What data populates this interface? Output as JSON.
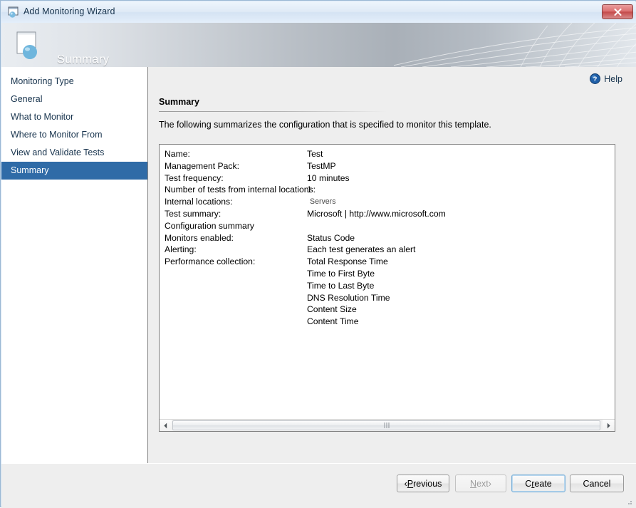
{
  "window": {
    "title": "Add Monitoring Wizard",
    "icon": "wizard-window-icon",
    "close_label": "x"
  },
  "banner": {
    "title": "Summary",
    "icon": "wizard-page-icon"
  },
  "sidebar": {
    "items": [
      {
        "label": "Monitoring Type",
        "selected": false
      },
      {
        "label": "General",
        "selected": false
      },
      {
        "label": "What to Monitor",
        "selected": false
      },
      {
        "label": "Where to Monitor From",
        "selected": false
      },
      {
        "label": "View and Validate Tests",
        "selected": false
      },
      {
        "label": "Summary",
        "selected": true
      }
    ],
    "selected_color": "#2f6ba7"
  },
  "content": {
    "help_label": "Help",
    "help_icon": "help-circle-icon",
    "section_title": "Summary",
    "intro_text": "The following summarizes the configuration that is specified to monitor this template.",
    "rows": [
      {
        "label": "Name:",
        "value": "Test",
        "sub": false
      },
      {
        "label": "Management Pack:",
        "value": "TestMP",
        "sub": false
      },
      {
        "label": "Test frequency:",
        "value": "10 minutes",
        "sub": false
      },
      {
        "label": "Number of tests from internal locations:",
        "value": "1",
        "sub": false
      },
      {
        "label": "Internal locations:",
        "value": "Servers",
        "sub": true
      },
      {
        "label": "Test summary:",
        "value": "Microsoft | http://www.microsoft.com",
        "sub": false
      },
      {
        "label": "Configuration summary",
        "value": "",
        "sub": false
      },
      {
        "label": "Monitors enabled:",
        "value": "Status Code",
        "sub": false
      },
      {
        "label": "Alerting:",
        "value": "Each test generates an alert",
        "sub": false
      },
      {
        "label": "Performance collection:",
        "value": "Total Response Time",
        "sub": false
      },
      {
        "label": "",
        "value": "Time to First Byte",
        "sub": false
      },
      {
        "label": "",
        "value": "Time to Last Byte",
        "sub": false
      },
      {
        "label": "",
        "value": "DNS Resolution Time",
        "sub": false
      },
      {
        "label": "",
        "value": "Content Size",
        "sub": false
      },
      {
        "label": "",
        "value": "Content Time",
        "sub": false
      }
    ],
    "scrollbar": {
      "left_arrow": "◀",
      "right_arrow": "▶"
    }
  },
  "footer": {
    "buttons": [
      {
        "name": "previous",
        "prefix": "‹ ",
        "accel": "P",
        "rest": "revious",
        "suffix": "",
        "state": "normal"
      },
      {
        "name": "next",
        "prefix": "",
        "accel": "N",
        "rest": "ext",
        "suffix": " ›",
        "state": "disabled"
      },
      {
        "name": "create",
        "prefix": "C",
        "accel": "r",
        "rest": "eate",
        "suffix": "",
        "state": "default"
      },
      {
        "name": "cancel",
        "prefix": "Cancel",
        "accel": "",
        "rest": "",
        "suffix": "",
        "state": "normal"
      }
    ]
  }
}
